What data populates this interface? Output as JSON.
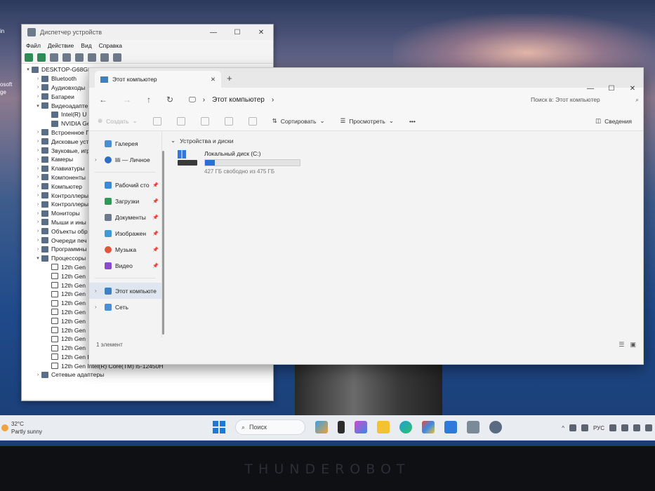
{
  "desktop": {
    "left_labels": [
      "in",
      "osoft",
      "ge"
    ]
  },
  "device_manager": {
    "title": "Диспетчер устройств",
    "menu": [
      "Файл",
      "Действие",
      "Вид",
      "Справка"
    ],
    "tree": [
      {
        "label": "DESKTOP-G68GE",
        "level": 0,
        "arrow": "v"
      },
      {
        "label": "Bluetooth",
        "level": 1,
        "arrow": ">"
      },
      {
        "label": "Аудиовходы",
        "level": 1,
        "arrow": ">"
      },
      {
        "label": "Батареи",
        "level": 1,
        "arrow": ">"
      },
      {
        "label": "Видеоадапте",
        "level": 1,
        "arrow": "v"
      },
      {
        "label": "Intel(R) U",
        "level": 2,
        "arrow": ""
      },
      {
        "label": "NVIDIA Ge",
        "level": 2,
        "arrow": ""
      },
      {
        "label": "Встроенное П",
        "level": 1,
        "arrow": ">"
      },
      {
        "label": "Дисковые уст",
        "level": 1,
        "arrow": ">"
      },
      {
        "label": "Звуковые, игр",
        "level": 1,
        "arrow": ">"
      },
      {
        "label": "Камеры",
        "level": 1,
        "arrow": ">"
      },
      {
        "label": "Клавиатуры",
        "level": 1,
        "arrow": ">"
      },
      {
        "label": "Компоненты",
        "level": 1,
        "arrow": ">"
      },
      {
        "label": "Компьютер",
        "level": 1,
        "arrow": ">"
      },
      {
        "label": "Контроллеры",
        "level": 1,
        "arrow": ">"
      },
      {
        "label": "Контроллеры",
        "level": 1,
        "arrow": ">"
      },
      {
        "label": "Мониторы",
        "level": 1,
        "arrow": ">"
      },
      {
        "label": "Мыши и ины",
        "level": 1,
        "arrow": ">"
      },
      {
        "label": "Объекты обр",
        "level": 1,
        "arrow": ">"
      },
      {
        "label": "Очереди печ",
        "level": 1,
        "arrow": ">"
      },
      {
        "label": "Программны",
        "level": 1,
        "arrow": ">"
      },
      {
        "label": "Процессоры",
        "level": 1,
        "arrow": "v"
      },
      {
        "label": "12th Gen",
        "level": 2,
        "arrow": ""
      },
      {
        "label": "12th Gen",
        "level": 2,
        "arrow": ""
      },
      {
        "label": "12th Gen",
        "level": 2,
        "arrow": ""
      },
      {
        "label": "12th Gen",
        "level": 2,
        "arrow": ""
      },
      {
        "label": "12th Gen",
        "level": 2,
        "arrow": ""
      },
      {
        "label": "12th Gen",
        "level": 2,
        "arrow": ""
      },
      {
        "label": "12th Gen",
        "level": 2,
        "arrow": ""
      },
      {
        "label": "12th Gen",
        "level": 2,
        "arrow": ""
      },
      {
        "label": "12th Gen",
        "level": 2,
        "arrow": ""
      },
      {
        "label": "12th Gen",
        "level": 2,
        "arrow": ""
      },
      {
        "label": "12th Gen Intel(R) Core(TM) i5-12450H",
        "level": 2,
        "arrow": ""
      },
      {
        "label": "12th Gen Intel(R) Core(TM) i5-12450H",
        "level": 2,
        "arrow": ""
      },
      {
        "label": "Сетевые адаптеры",
        "level": 1,
        "arrow": ">"
      }
    ]
  },
  "explorer": {
    "tab_title": "Этот компьютер",
    "breadcrumb": "Этот компьютер",
    "search_placeholder": "Поиск в: Этот компьютер",
    "cmd": {
      "create": "Создать",
      "sort": "Сортировать",
      "view": "Просмотреть",
      "more": "•••",
      "details": "Сведения"
    },
    "nav": {
      "gallery": "Галерея",
      "onedrive": "lili — Личное",
      "desktop": "Рабочий сто",
      "downloads": "Загрузки",
      "documents": "Документы",
      "pictures": "Изображен",
      "music": "Музыка",
      "video": "Видео",
      "this_pc": "Этот компьюте",
      "network": "Сеть"
    },
    "group_title": "Устройства и диски",
    "drive": {
      "name": "Локальный диск (C:)",
      "free_text": "427 ГБ свободно из 475 ГБ",
      "used_fraction": 0.101
    },
    "status": "1 элемент"
  },
  "taskbar": {
    "weather_temp": "32°C",
    "weather_desc": "Partly sunny",
    "search_label": "Поиск",
    "lang": "РУС"
  },
  "brand": "THUNDEROBOT"
}
